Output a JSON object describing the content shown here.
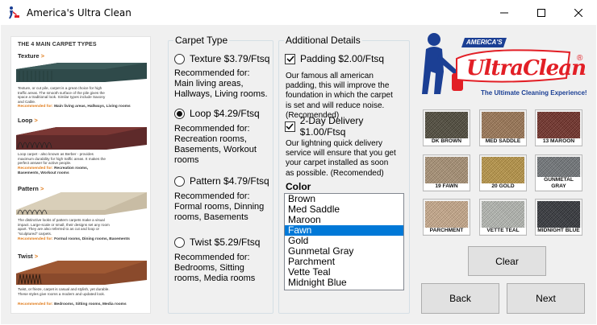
{
  "window": {
    "title": "America's Ultra Clean",
    "icon": "vacuum-person-icon",
    "minimize_icon": "minimize-icon",
    "maximize_icon": "maximize-icon",
    "close_icon": "close-icon"
  },
  "guide": {
    "heading": "THE 4 MAIN CARPET TYPES",
    "items": [
      {
        "name": "Texture",
        "arrow": ">",
        "desc": "Texture, or cut pile, carpet is a great choice for high traffic areas. The smooth surface of the pile gives the space a traditional look. Similar types include Saxony and Cable.",
        "rec_key": "Recommended for:",
        "rec_value": "Main living areas, Hallways, Living rooms"
      },
      {
        "name": "Loop",
        "arrow": ">",
        "desc": "Loop carpet - also known as Berber - provides maximum durability for high traffic areas. It makes the perfect answer for active people.",
        "rec_key": "Recommended for:",
        "rec_value": "Recreation rooms, Basements, Workout rooms"
      },
      {
        "name": "Pattern",
        "arrow": ">",
        "desc": "The distinctive looks of pattern carpets make a visual impact. Large-scale or small, their designs set any room apart. They are also referred to as cut and loop or \"sculptured\" carpets.",
        "rec_key": "Recommended for:",
        "rec_value": "Formal rooms, Dining rooms, Basements"
      },
      {
        "name": "Twist",
        "arrow": ">",
        "desc": "Twist, or frieze, carpet is casual and stylish, yet durable. These styles give rooms a modern and updated look.",
        "rec_key": "Recommended for:",
        "rec_value": "Bedrooms, Sitting rooms, Media rooms"
      }
    ]
  },
  "carpet_type": {
    "legend": "Carpet Type",
    "selected": "Loop",
    "options": [
      {
        "label": "Texture $3.79/Ftsq",
        "checked": false,
        "rec": "Recommended for: Main living areas, Hallways, Living rooms."
      },
      {
        "label": "Loop $4.29/Ftsq",
        "checked": true,
        "rec": "Recommended for: Recreation rooms, Basements, Workout rooms"
      },
      {
        "label": "Pattern $4.79/Ftsq",
        "checked": false,
        "rec": "Recommended for: Formal rooms, Dinning rooms, Basements"
      },
      {
        "label": "Twist $5.29/Ftsq",
        "checked": false,
        "rec": "Recommended for: Bedrooms, Sitting rooms, Media rooms"
      }
    ]
  },
  "details": {
    "legend": "Additional Details",
    "padding": {
      "label": "Padding $2.00/Ftsq",
      "checked": true,
      "desc": "Our famous all american padding, this will improve the foundation in which the carpet is set and will reduce noise. (Recomended)"
    },
    "delivery": {
      "label": "2-Day Delivery $1.00/Ftsq",
      "checked": true,
      "desc": "Our lightning quick delivery service will ensure that you get your carpet installed as soon as possible. (Recomended)"
    },
    "color_label": "Color",
    "colors": [
      "Brown",
      "Med Saddle",
      "Maroon",
      "Fawn",
      "Gold",
      "Gunmetal Gray",
      "Parchment",
      "Vette Teal",
      "Midnight Blue"
    ],
    "selected_color": "Fawn"
  },
  "logo": {
    "banner": "AMERICA'S",
    "brand": "UltraClean",
    "registered": "®",
    "tagline": "The Ultimate Cleaning Experience!",
    "primary_color": "#e21f26",
    "secondary_color": "#1b3f94"
  },
  "swatches": [
    {
      "label": "DK BROWN",
      "color": "#4a4536"
    },
    {
      "label": "MED SADDLE",
      "color": "#9a7350"
    },
    {
      "label": "13 MAROON",
      "color": "#6e2a22"
    },
    {
      "label": "19 FAWN",
      "color": "#a89072"
    },
    {
      "label": "20 GOLD",
      "color": "#b99442"
    },
    {
      "label": "GUNMETAL GRAY",
      "color": "#6f7377"
    },
    {
      "label": "PARCHMENT",
      "color": "#c9a98a"
    },
    {
      "label": "VETTE TEAL",
      "color": "#b5b8b2"
    },
    {
      "label": "MIDNIGHT BLUE",
      "color": "#2e3035"
    }
  ],
  "buttons": {
    "clear": "Clear",
    "back": "Back",
    "next": "Next"
  }
}
